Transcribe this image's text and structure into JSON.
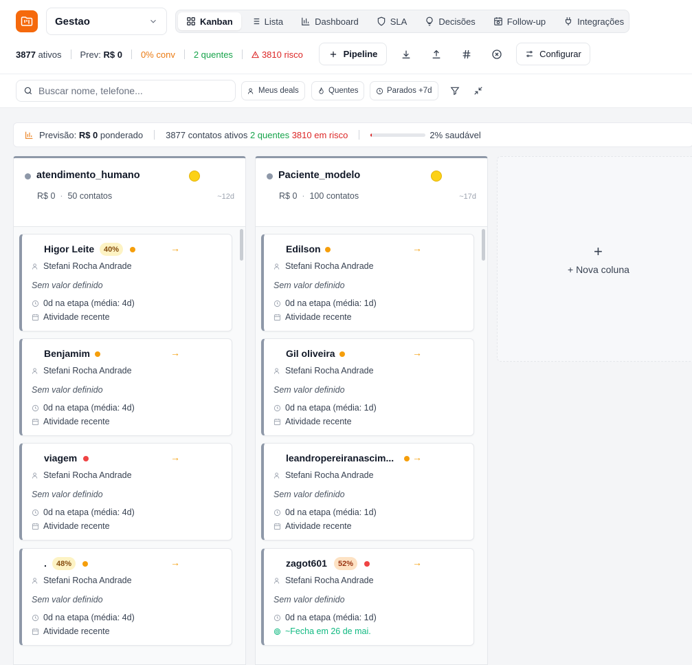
{
  "header": {
    "pipeline_name": "Gestao",
    "tabs": [
      {
        "label": "Kanban",
        "icon": "grid-icon",
        "active": true
      },
      {
        "label": "Lista",
        "icon": "list-icon"
      },
      {
        "label": "Dashboard",
        "icon": "bar-chart-icon"
      },
      {
        "label": "SLA",
        "icon": "shield-icon"
      },
      {
        "label": "Decisões",
        "icon": "lightbulb-icon"
      },
      {
        "label": "Follow-up",
        "icon": "calendar-clock-icon"
      },
      {
        "label": "Integrações",
        "icon": "plug-icon"
      }
    ]
  },
  "stats": {
    "active_count": "3877",
    "active_label": "ativos",
    "forecast_label": "Prev:",
    "forecast_value": "R$ 0",
    "conversion": "0% conv",
    "hot": "2 quentes",
    "risk": "3810 risco"
  },
  "toolbar": {
    "pipeline_button": "Pipeline",
    "configure_button": "Configurar"
  },
  "search": {
    "placeholder": "Buscar nome, telefone..."
  },
  "filters": {
    "my_deals": "Meus deals",
    "hot": "Quentes",
    "stalled": "Parados +7d"
  },
  "forecast_bar": {
    "label": "Previsão:",
    "value": "R$ 0",
    "suffix": "ponderado",
    "active_contacts": "3877 contatos ativos",
    "hot": "2 quentes",
    "risk": "3810 em risco",
    "health_percent": 2,
    "health_label": "2% saudável"
  },
  "columns": [
    {
      "title": "atendimento_humano",
      "value": "R$ 0",
      "separator": "·",
      "contacts": "50 contatos",
      "days": "~12d",
      "cards": [
        {
          "name": "Higor Leite",
          "probability": "40%",
          "prob_style": "yellow",
          "dot": "orange",
          "owner": "Stefani Rocha Andrade",
          "value": "Sem valor definido",
          "stage_time": "0d na etapa (média: 4d)",
          "activity": "Atividade recente"
        },
        {
          "name": "Benjamim",
          "dot": "orange",
          "owner": "Stefani Rocha Andrade",
          "value": "Sem valor definido",
          "stage_time": "0d na etapa (média: 4d)",
          "activity": "Atividade recente"
        },
        {
          "name": "viagem",
          "dot": "red",
          "owner": "Stefani Rocha Andrade",
          "value": "Sem valor definido",
          "stage_time": "0d na etapa (média: 4d)",
          "activity": "Atividade recente"
        },
        {
          "name": ".",
          "probability": "48%",
          "prob_style": "yellow",
          "dot": "orange",
          "owner": "Stefani Rocha Andrade",
          "value": "Sem valor definido",
          "stage_time": "0d na etapa (média: 4d)",
          "activity": "Atividade recente"
        }
      ]
    },
    {
      "title": "Paciente_modelo",
      "value": "R$ 0",
      "separator": "·",
      "contacts": "100 contatos",
      "days": "~17d",
      "cards": [
        {
          "name": "Edilson",
          "dot": "orange",
          "owner": "Stefani Rocha Andrade",
          "value": "Sem valor definido",
          "stage_time": "0d na etapa (média: 1d)",
          "activity": "Atividade recente"
        },
        {
          "name": "Gil oliveira",
          "dot": "orange",
          "owner": "Stefani Rocha Andrade",
          "value": "Sem valor definido",
          "stage_time": "0d na etapa (média: 1d)",
          "activity": "Atividade recente"
        },
        {
          "name": "leandropereiranascim...",
          "dot": "orange",
          "owner": "Stefani Rocha Andrade",
          "value": "Sem valor definido",
          "stage_time": "0d na etapa (média: 1d)",
          "activity": "Atividade recente"
        },
        {
          "name": "zagot601",
          "probability": "52%",
          "prob_style": "peach",
          "dot": "red",
          "owner": "Stefani Rocha Andrade",
          "value": "Sem valor definido",
          "stage_time": "0d na etapa (média: 1d)",
          "close_estimate": "~Fecha em 26 de mai."
        }
      ]
    }
  ],
  "new_column": {
    "plus": "+",
    "label": "+ Nova coluna"
  },
  "colors": {
    "brand": "#f5690c",
    "hot": "#16a34a",
    "risk": "#dc2626",
    "stage_accent": "#8e98a8",
    "dot_orange": "#f59e0b",
    "dot_red": "#ef4444"
  }
}
